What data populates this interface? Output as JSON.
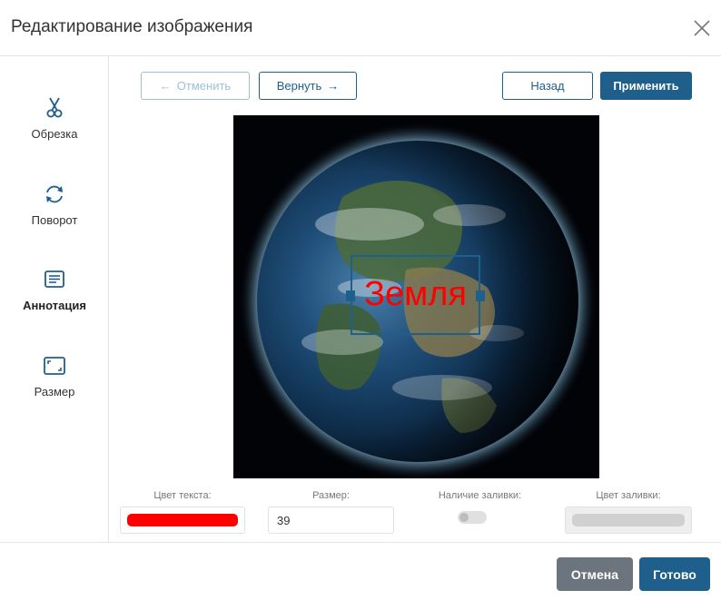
{
  "dialog": {
    "title": "Редактирование изображения"
  },
  "sidebar": {
    "items": [
      {
        "label": "Обрезка",
        "icon": "scissors-icon"
      },
      {
        "label": "Поворот",
        "icon": "rotate-icon"
      },
      {
        "label": "Аннотация",
        "icon": "annotation-icon",
        "active": true
      },
      {
        "label": "Размер",
        "icon": "resize-icon"
      }
    ]
  },
  "toolbar": {
    "undo_label": "Отменить",
    "undo_arrow": "←",
    "redo_label": "Вернуть",
    "redo_arrow": "→",
    "back_label": "Назад",
    "apply_label": "Применить"
  },
  "canvas": {
    "annotation_text": "Земля",
    "annotation_color": "#ff0000",
    "selection_color": "#1e5f8c"
  },
  "properties": {
    "text_color_label": "Цвет текста:",
    "text_color_value": "#ff0000",
    "size_label": "Размер:",
    "size_value": "39",
    "fill_presence_label": "Наличие заливки:",
    "fill_enabled": false,
    "fill_color_label": "Цвет заливки:",
    "fill_color_value": "#d0d0d0"
  },
  "footer": {
    "cancel_label": "Отмена",
    "done_label": "Готово"
  },
  "colors": {
    "primary": "#1e5f8c",
    "primary_light": "#9cc0d8",
    "secondary_button": "#6c757d"
  }
}
